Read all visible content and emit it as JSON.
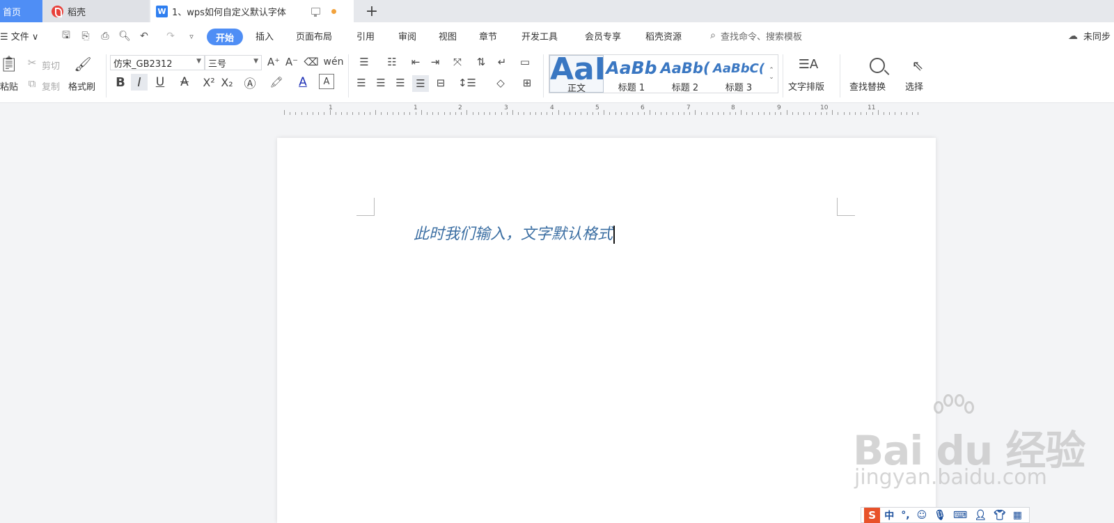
{
  "tabs": {
    "home": "首页",
    "daoke": "稻壳",
    "document": "1、wps如何自定义默认字体",
    "doc_icon_letter": "W",
    "new_tab": "+"
  },
  "menu": {
    "file": "☰ 文件 ∨",
    "start": "开始",
    "items": [
      "插入",
      "页面布局",
      "引用",
      "审阅",
      "视图",
      "章节",
      "开发工具",
      "会员专享",
      "稻壳资源"
    ],
    "search_placeholder": "查找命令、搜索模板",
    "sync": "未同步"
  },
  "ribbon": {
    "paste": "粘贴",
    "cut": "剪切",
    "copy": "复制",
    "format_painter": "格式刷",
    "font_name": "仿宋_GB2312",
    "font_size": "三号",
    "bold": "B",
    "italic": "I",
    "underline": "U",
    "superscript": "X²",
    "subscript": "X₂",
    "styles": [
      {
        "sample": "AaB",
        "label": "正文"
      },
      {
        "sample": "AaBb",
        "label": "标题 1"
      },
      {
        "sample": "AaBb(",
        "label": "标题 2"
      },
      {
        "sample": "AaBbC(",
        "label": "标题 3"
      }
    ],
    "text_layout": "文字排版",
    "find_replace": "查找替换",
    "select": "选择"
  },
  "ruler": {
    "numbers": [
      "1",
      "1",
      "2",
      "3",
      "4",
      "5",
      "6",
      "7",
      "8",
      "9",
      "10",
      "11"
    ]
  },
  "document": {
    "text": "此时我们输入，文字默认格式"
  },
  "watermark": {
    "main": "Bai  du 经验",
    "sub": "jingyan.baidu.com"
  },
  "ime": {
    "logo": "S",
    "mode": "中",
    "punct": "°,"
  },
  "colors": {
    "accent": "#4f8ef5",
    "doc_text": "#3c6fa3",
    "style_sample": "#3a77c2"
  }
}
